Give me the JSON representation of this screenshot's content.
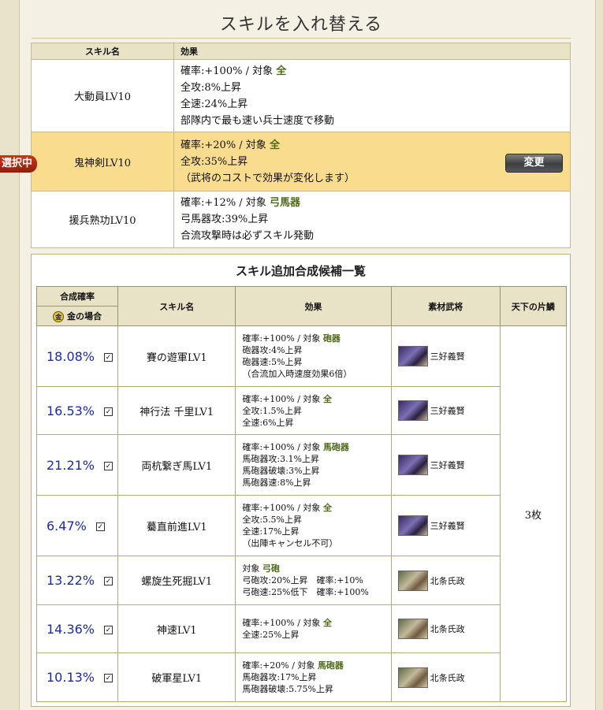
{
  "page_title": "スキルを入れ替える",
  "current": {
    "headers": {
      "name": "スキル名",
      "effect": "効果"
    },
    "rows": [
      {
        "name": "大動員LV10",
        "l1_prefix": "確率:+100% / 対象",
        "l1_target": "全",
        "l2": "全攻:8%上昇",
        "l3": "全速:24%上昇",
        "l4": "部隊内で最も速い兵士速度で移動"
      },
      {
        "name": "鬼神剣LV10",
        "l1_prefix": "確率:+20% / 対象",
        "l1_target": "全",
        "l2": "全攻:35%上昇",
        "l3": "（武将のコストで効果が変化します）"
      },
      {
        "name": "援兵熟功LV10",
        "l1_prefix": "確率:+12% / 対象",
        "l1_target": "弓馬器",
        "l2": "弓馬器攻:39%上昇",
        "l3": "合流攻撃時は必ずスキル発動"
      }
    ],
    "selected_badge": "選択中",
    "change_button": "変更"
  },
  "candidates": {
    "title": "スキル追加合成候補一覧",
    "headers": {
      "rate": "合成確率",
      "gold_case": "金の場合",
      "name": "スキル名",
      "effect": "効果",
      "material": "素材武将",
      "pieces": "天下の片鱗"
    },
    "pieces_value": "3枚",
    "rows": [
      {
        "rate": "18.08%",
        "name": "賽の遊軍LV1",
        "l1_prefix": "確率:+100% / 対象",
        "l1_target": "砲器",
        "l2": "砲器攻:4%上昇",
        "l3": "砲器速:5%上昇",
        "l4": "（合流加入時速度効果6倍）",
        "general": "三好義賢"
      },
      {
        "rate": "16.53%",
        "name": "神行法 千里LV1",
        "l1_prefix": "確率:+100% / 対象",
        "l1_target": "全",
        "l2": "全攻:1.5%上昇",
        "l3": "全速:6%上昇",
        "general": "三好義賢"
      },
      {
        "rate": "21.21%",
        "name": "両杭繋ぎ馬LV1",
        "l1_prefix": "確率:+100% / 対象",
        "l1_target": "馬砲器",
        "l2": "馬砲器攻:3.1%上昇",
        "l3": "馬砲器破壊:3%上昇",
        "l4": "馬砲器速:8%上昇",
        "general": "三好義賢"
      },
      {
        "rate": "6.47%",
        "name": "驀直前進LV1",
        "l1_prefix": "確率:+100% / 対象",
        "l1_target": "全",
        "l2": "全攻:5.5%上昇",
        "l3": "全速:17%上昇",
        "l4": "（出陣キャンセル不可）",
        "general": "三好義賢"
      },
      {
        "rate": "13.22%",
        "name": "螺旋生死掘LV1",
        "l1_prefix": "対象",
        "l1_target": "弓砲",
        "l2": "弓砲攻:20%上昇　確率:+10%",
        "l3": "弓砲速:25%低下　確率:+100%",
        "general": "北条氏政"
      },
      {
        "rate": "14.36%",
        "name": "神速LV1",
        "l1_prefix": "確率:+100% / 対象",
        "l1_target": "全",
        "l2": "全速:25%上昇",
        "general": "北条氏政"
      },
      {
        "rate": "10.13%",
        "name": "破軍星LV1",
        "l1_prefix": "確率:+20% / 対象",
        "l1_target": "馬砲器",
        "l2": "馬砲器攻:17%上昇",
        "l3": "馬砲器破壊:5.75%上昇",
        "general": "北条氏政"
      }
    ]
  }
}
